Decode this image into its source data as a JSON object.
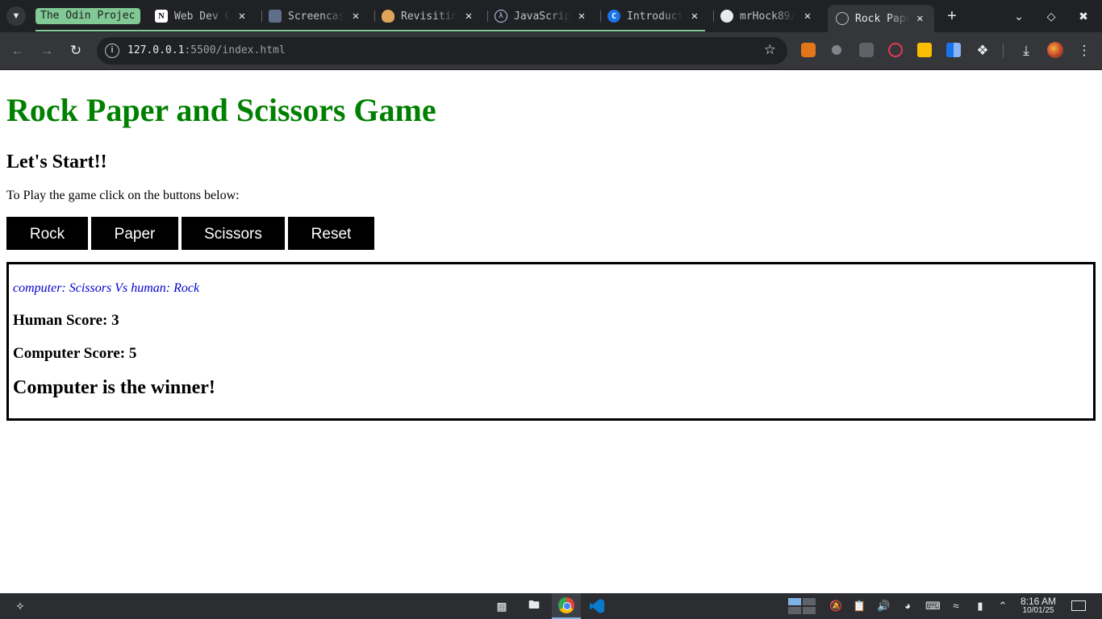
{
  "browser": {
    "tab_group_label": "The Odin Projec",
    "tabs": [
      {
        "title": "Web Dev C",
        "favicon": "notion-icon"
      },
      {
        "title": "Screencas",
        "favicon": "screencast-icon"
      },
      {
        "title": "Revisitin",
        "favicon": "fox-icon"
      },
      {
        "title": "JavaScrip",
        "favicon": "lambda-icon"
      },
      {
        "title": "Introduct",
        "favicon": "c-logo-icon"
      },
      {
        "title": "mrHock89/",
        "favicon": "github-icon"
      },
      {
        "title": "Rock Pape",
        "favicon": "globe-icon",
        "active": true
      }
    ],
    "url_host": "127.0.0.1",
    "url_path": ":5500/index.html"
  },
  "page": {
    "title": "Rock Paper and Scissors Game",
    "subtitle": "Let's Start!!",
    "instructions": "To Play the game click on the buttons below:",
    "buttons": {
      "rock": "Rock",
      "paper": "Paper",
      "scissors": "Scissors",
      "reset": "Reset"
    },
    "results": {
      "round_text": "computer: Scissors Vs human: Rock",
      "human_score": "Human Score: 3",
      "computer_score": "Computer Score: 5",
      "winner": "Computer is the winner!"
    },
    "colors": {
      "title": "#008000",
      "round_text": "#0000cd",
      "button_bg": "#000000",
      "button_text": "#ffffff"
    }
  },
  "taskbar": {
    "time": "8:16 AM",
    "date": "10/01/25"
  }
}
